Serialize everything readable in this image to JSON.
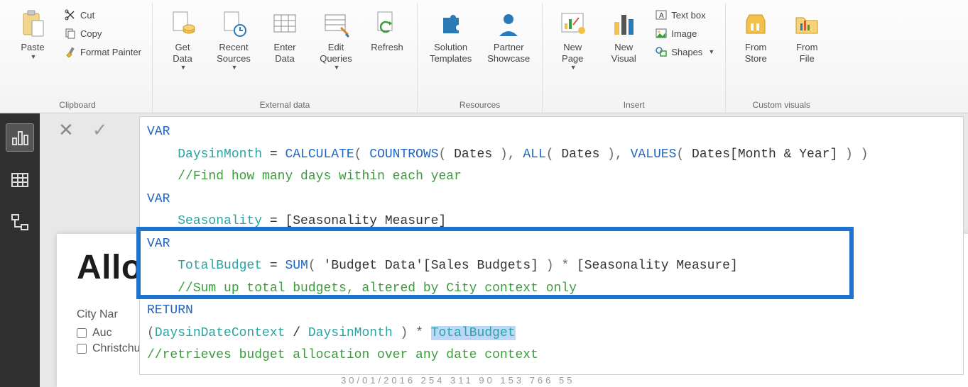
{
  "ribbon": {
    "clipboard": {
      "label": "Clipboard",
      "paste": "Paste",
      "cut": "Cut",
      "copy": "Copy",
      "format_painter": "Format Painter"
    },
    "external_data": {
      "label": "External data",
      "get_data": "Get\nData",
      "recent_sources": "Recent\nSources",
      "enter_data": "Enter\nData",
      "edit_queries": "Edit\nQueries",
      "refresh": "Refresh"
    },
    "resources": {
      "label": "Resources",
      "solution_templates": "Solution\nTemplates",
      "partner_showcase": "Partner\nShowcase"
    },
    "insert": {
      "label": "Insert",
      "new_page": "New\nPage",
      "new_visual": "New\nVisual",
      "text_box": "Text box",
      "image": "Image",
      "shapes": "Shapes"
    },
    "custom_visuals": {
      "label": "Custom visuals",
      "from_store": "From\nStore",
      "from_file": "From\nFile"
    }
  },
  "formula": {
    "l1_var": "VAR",
    "l2_ident": "DaysinMonth",
    "l2_eq": " = ",
    "l2_f1": "CALCULATE",
    "l2_p1": "( ",
    "l2_f2": "COUNTROWS",
    "l2_p2": "( ",
    "l2_a1": "Dates",
    "l2_p3": " ), ",
    "l2_f3": "ALL",
    "l2_p4": "( ",
    "l2_a2": "Dates",
    "l2_p5": " ), ",
    "l2_f4": "VALUES",
    "l2_p6": "( ",
    "l2_a3": "Dates[Month & Year]",
    "l2_p7": " ) )",
    "l3_comment": "//Find how many days within each year",
    "l4_var": "VAR",
    "l5_ident": "Seasonality",
    "l5_rest": " = [Seasonality Measure]",
    "l6_var": "VAR",
    "l7_ident": "TotalBudget",
    "l7_eq": " = ",
    "l7_f1": "SUM",
    "l7_p1": "( ",
    "l7_a1": "'Budget Data'[Sales Budgets]",
    "l7_p2": " ) * ",
    "l7_a2": "[Seasonality Measure]",
    "l8_comment": "//Sum up total budgets, altered by City context only",
    "l9_return": "RETURN",
    "l10_p1": "(",
    "l10_i1": "DaysinDateContext",
    "l10_mid": " / ",
    "l10_i2": "DaysinMonth",
    "l10_p2": " ) * ",
    "l10_sel": "TotalBudget",
    "l11_comment": "//retrieves budget allocation over any date context"
  },
  "page": {
    "title_partial": "Allo",
    "field_label": "City Nar",
    "items": [
      "Auc",
      "Christchurch"
    ],
    "table_stub": "30/01/2016        254 311 90        153 766 55"
  }
}
